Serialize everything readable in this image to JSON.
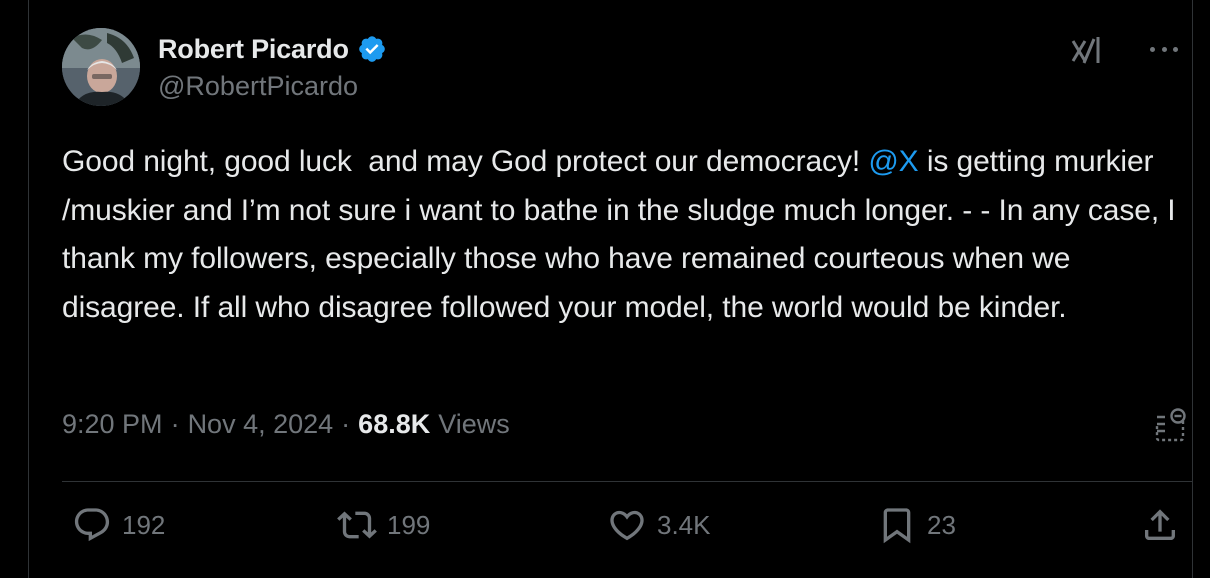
{
  "author": {
    "display_name": "Robert Picardo",
    "handle": "@RobertPicardo",
    "verified": true,
    "avatar_icon": "user-avatar-photo"
  },
  "header_icons": {
    "grok": "grok-icon",
    "more": "more-options-icon"
  },
  "tweet": {
    "text_before_mention": "Good night, good luck  and may God protect our democracy! ",
    "mention": "@X",
    "text_after_mention": " is getting murkier /muskier and I’m not sure i want to bathe in the sludge much longer. - - In any case, I thank my followers, especially those who have remained courteous when we disagree. If all who disagree followed your model, the world would be kinder."
  },
  "meta": {
    "time": "9:20 PM",
    "separator": "·",
    "date": "Nov 4, 2024",
    "views_count": "68.8K",
    "views_label": "Views"
  },
  "actions": {
    "reply_count": "192",
    "retweet_count": "199",
    "like_count": "3.4K",
    "bookmark_count": "23"
  },
  "colors": {
    "background": "#000000",
    "text_primary": "#e7e9ea",
    "text_secondary": "#71767b",
    "accent": "#1d9bf0",
    "divider": "#2f3336"
  }
}
